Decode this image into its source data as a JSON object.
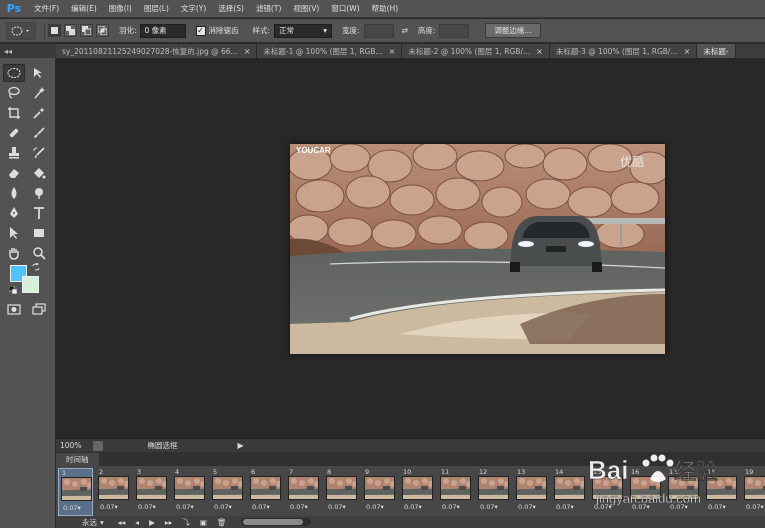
{
  "app": {
    "logo": "Ps"
  },
  "menu": [
    "文件(F)",
    "编辑(E)",
    "图像(I)",
    "图层(L)",
    "文字(Y)",
    "选择(S)",
    "滤镜(T)",
    "视图(V)",
    "窗口(W)",
    "帮助(H)"
  ],
  "options": {
    "feather_label": "羽化:",
    "feather_value": "0 像素",
    "antialias_label": "消除锯齿",
    "style_label": "样式:",
    "style_value": "正常",
    "width_label": "宽度:",
    "height_label": "高度:",
    "refine_button": "调整边缘..."
  },
  "tabs": [
    {
      "label": "sy_20110821125249027028-恢复的.jpg @ 66...",
      "active": false
    },
    {
      "label": "未标题-1 @ 100% (图层 1, RGB...",
      "active": false
    },
    {
      "label": "未标题-2 @ 100% (图层 1, RGB/...",
      "active": false
    },
    {
      "label": "未标题-3 @ 100% (图层 1, RGB/...",
      "active": false
    },
    {
      "label": "未标题-",
      "active": true
    }
  ],
  "tab_close": "×",
  "toolbar_collapse": "◂◂",
  "canvas": {
    "watermark_left": "YOUCAR",
    "watermark_right": "优酷"
  },
  "status": {
    "zoom": "100%",
    "doc_info": "椭圆选框",
    "arrow": "▶"
  },
  "timeline": {
    "tab_label": "时间轴",
    "frames": [
      {
        "num": "1",
        "delay": "0.07▾"
      },
      {
        "num": "2",
        "delay": "0.07▾"
      },
      {
        "num": "3",
        "delay": "0.07▾"
      },
      {
        "num": "4",
        "delay": "0.07▾"
      },
      {
        "num": "5",
        "delay": "0.07▾"
      },
      {
        "num": "6",
        "delay": "0.07▾"
      },
      {
        "num": "7",
        "delay": "0.07▾"
      },
      {
        "num": "8",
        "delay": "0.07▾"
      },
      {
        "num": "9",
        "delay": "0.07▾"
      },
      {
        "num": "10",
        "delay": "0.07▾"
      },
      {
        "num": "11",
        "delay": "0.07▾"
      },
      {
        "num": "12",
        "delay": "0.07▾"
      },
      {
        "num": "13",
        "delay": "0.07▾"
      },
      {
        "num": "14",
        "delay": "0.07▾"
      },
      {
        "num": "15",
        "delay": "0.07▾"
      },
      {
        "num": "16",
        "delay": "0.07▾"
      },
      {
        "num": "17",
        "delay": "0.07▾"
      },
      {
        "num": "18",
        "delay": "0.07▾"
      },
      {
        "num": "19",
        "delay": "0.07▾"
      }
    ],
    "loop_label": "永远",
    "loop_caret": "▾",
    "controls": [
      "◂◂",
      "◂",
      "▶",
      "▸▸"
    ]
  },
  "baidu_watermark": {
    "brand_left": "Bai",
    "brand_right": "经验",
    "url": "jingyan.baidu.com"
  },
  "colors": {
    "foreground": "#4fc3f7",
    "background": "#d6efd8",
    "ps_blue": "#31a8ff"
  }
}
